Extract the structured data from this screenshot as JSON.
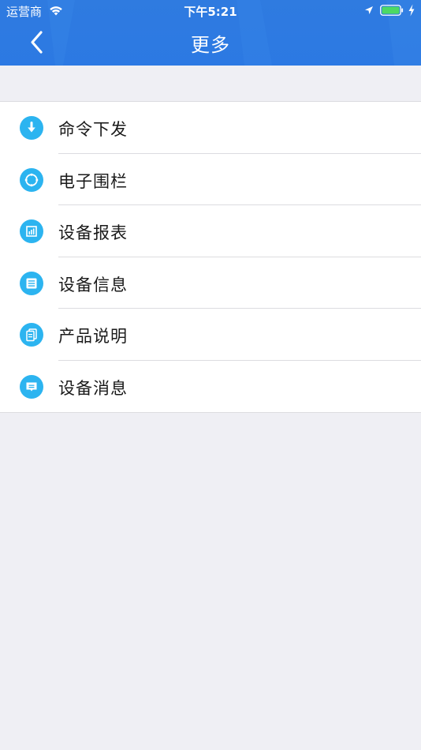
{
  "status_bar": {
    "carrier": "运营商",
    "time": "下午5:21"
  },
  "nav": {
    "title": "更多"
  },
  "menu": {
    "items": [
      {
        "label": "命令下发",
        "icon": "download-icon"
      },
      {
        "label": "电子围栏",
        "icon": "fence-circle-icon"
      },
      {
        "label": "设备报表",
        "icon": "chart-icon"
      },
      {
        "label": "设备信息",
        "icon": "info-list-icon"
      },
      {
        "label": "产品说明",
        "icon": "document-icon"
      },
      {
        "label": "设备消息",
        "icon": "message-icon"
      }
    ]
  },
  "colors": {
    "nav_bar": "#2f7be0",
    "icon_accent": "#2cb4f0",
    "page_background": "#efeff4"
  }
}
